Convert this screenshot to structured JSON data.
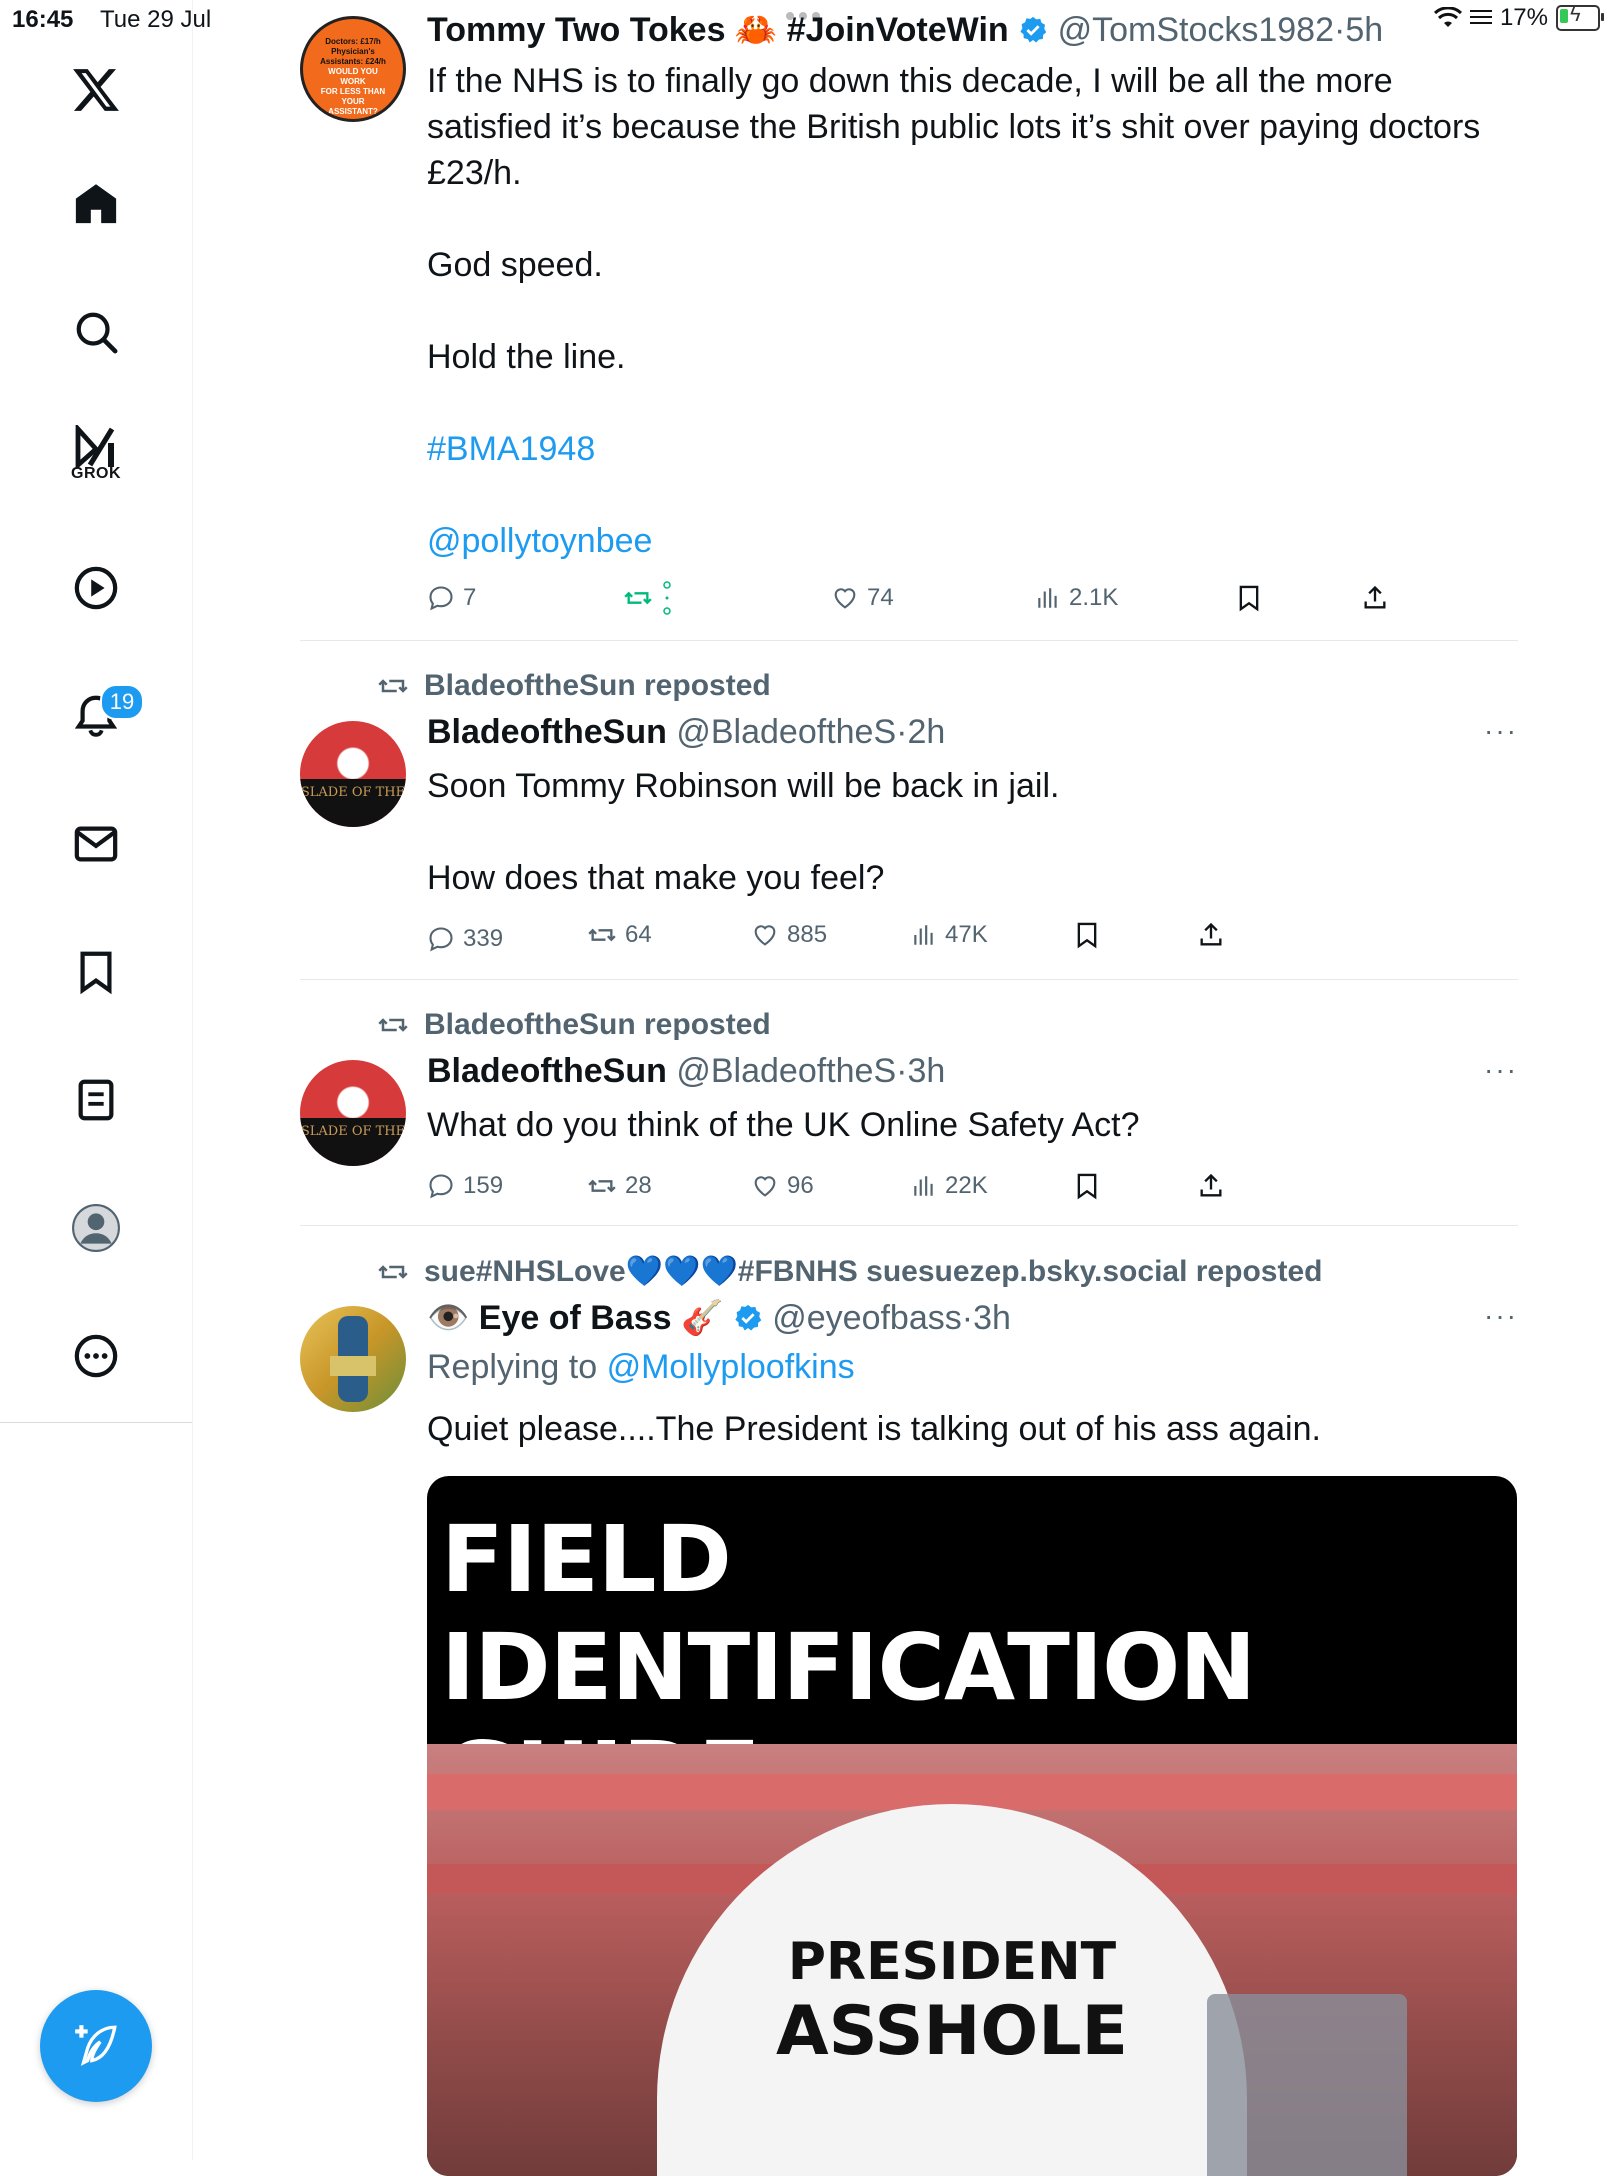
{
  "status_bar": {
    "time": "16:45",
    "date": "Tue 29 Jul",
    "battery": "17%"
  },
  "sidebar": {
    "grok_label": "GROK",
    "notifications_badge": "19"
  },
  "tweets": [
    {
      "name": "Tommy Two Tokes 🦀 #JoinVoteWin",
      "handle": "@TomStocks1982",
      "time": "5h",
      "lines": [
        "If the NHS is to finally go down this decade, I will be all the more",
        "satisfied it’s because the British public lots it’s shit over paying doctors",
        "£23/h."
      ],
      "para2": "God speed.",
      "para3": "Hold the line.",
      "hashtag": "#BMA1948",
      "mention": "@pollytoynbee",
      "replies": "7",
      "likes": "74",
      "views": "2.1K",
      "avatar_text": [
        "Doctors: £17/h",
        "Physician's",
        "Assistants: £24/h",
        "WOULD YOU WORK",
        "FOR LESS THAN",
        "YOUR ASSISTANT?"
      ]
    },
    {
      "repost_label": "BladeoftheSun reposted",
      "name": "BladeoftheSun",
      "handle": "@BladeoftheS",
      "time": "2h",
      "line1": "Soon Tommy Robinson will be back in jail.",
      "line2": "How does that make you feel?",
      "replies": "339",
      "reposts": "64",
      "likes": "885",
      "views": "47K",
      "avatar_text": "SLADE OF THE"
    },
    {
      "repost_label": "BladeoftheSun reposted",
      "name": "BladeoftheSun",
      "handle": "@BladeoftheS",
      "time": "3h",
      "line1": "What do you think of the UK Online Safety Act?",
      "replies": "159",
      "reposts": "28",
      "likes": "96",
      "views": "22K",
      "avatar_text": "SLADE OF THE"
    },
    {
      "repost_label": "sue#NHSLove💙💙💙#FBNHS suesuezep.bsky.social reposted",
      "name": "👁️ Eye of Bass 🎸",
      "handle": "@eyeofbass",
      "time": "3h",
      "replying_prefix": "Replying to",
      "replying_to": "@Mollyploofkins",
      "line1": "Quiet please....The President is talking out of his ass again.",
      "media_title_1": "FIELD IDENTIFICATION",
      "media_title_2": "GUIDE",
      "helmet_line1": "PRESIDENT",
      "helmet_line2": "ASSHOLE"
    }
  ],
  "more_label": "···",
  "separator": "·"
}
